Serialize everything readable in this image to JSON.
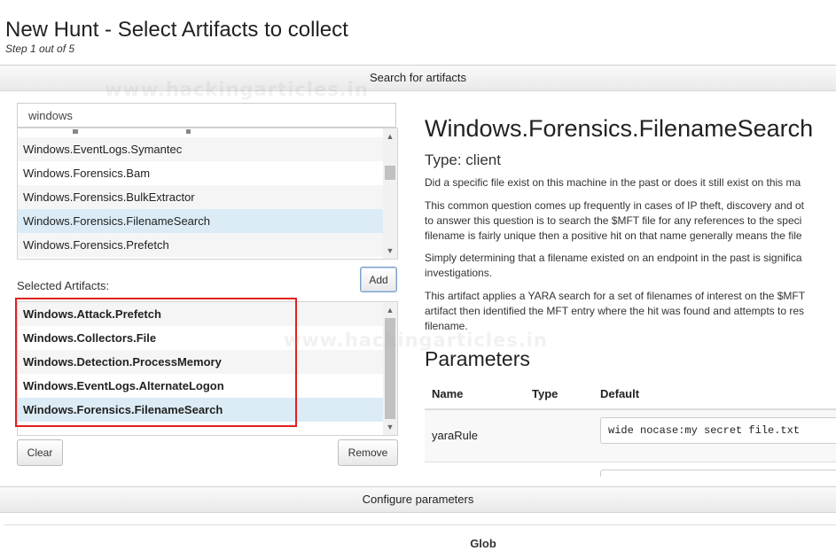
{
  "header": {
    "title": "New Hunt - Select Artifacts to collect",
    "subtitle": "Step 1 out of 5"
  },
  "search_section": {
    "label": "Search for artifacts",
    "search_value": "windows"
  },
  "available_artifacts": {
    "items": [
      {
        "label": "Windows.EventLogs.Symantec",
        "selected": false
      },
      {
        "label": "Windows.Forensics.Bam",
        "selected": false
      },
      {
        "label": "Windows.Forensics.BulkExtractor",
        "selected": false
      },
      {
        "label": "Windows.Forensics.FilenameSearch",
        "selected": true
      },
      {
        "label": "Windows.Forensics.Prefetch",
        "selected": false
      }
    ]
  },
  "add_button": "Add",
  "selected_artifacts": {
    "label": "Selected Artifacts:",
    "items": [
      {
        "label": "Windows.Attack.Prefetch",
        "selected": false
      },
      {
        "label": "Windows.Collectors.File",
        "selected": false
      },
      {
        "label": "Windows.Detection.ProcessMemory",
        "selected": false
      },
      {
        "label": "Windows.EventLogs.AlternateLogon",
        "selected": false
      },
      {
        "label": "Windows.Forensics.FilenameSearch",
        "selected": true
      }
    ]
  },
  "buttons": {
    "clear": "Clear",
    "remove": "Remove"
  },
  "detail": {
    "name": "Windows.Forensics.FilenameSearch",
    "type": "Type: client",
    "description": [
      "Did a specific file exist on this machine in the past or does it still exist on this ma",
      "This common question comes up frequently in cases of IP theft, discovery and ot",
      "to answer this question is to search the $MFT file for any references to the speci",
      "filename is fairly unique then a positive hit on that name generally means the file",
      "Simply determining that a filename existed on an endpoint in the past is significa",
      "investigations.",
      "This artifact applies a YARA search for a set of filenames of interest on the $MFT",
      "artifact then identified the MFT entry where the hit was found and attempts to res",
      "filename."
    ],
    "parameters_heading": "Parameters",
    "columns": {
      "name": "Name",
      "type": "Type",
      "default": "Default"
    },
    "params": [
      {
        "name": "yaraRule",
        "type": "",
        "default": "wide nocase:my secret file.txt"
      }
    ]
  },
  "configure_section": {
    "label": "Configure parameters"
  },
  "glob_label": "Glob",
  "watermark": "www.hackingarticles.in",
  "colors": {
    "selected_row": "#dcecf6",
    "highlight_box": "#e02020"
  }
}
